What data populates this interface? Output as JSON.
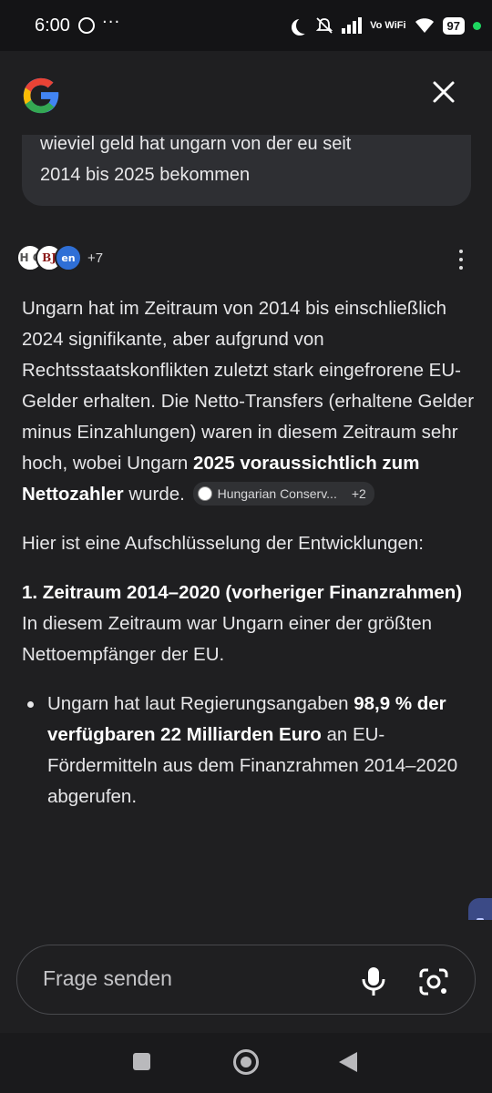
{
  "status_bar": {
    "time": "6:00",
    "overflow": "···",
    "network_label": "Vo WiFi",
    "battery": "97"
  },
  "header": {
    "logo": "google-g-icon",
    "close": "close-icon"
  },
  "query": {
    "text_line1": "wieviel geld hat ungarn von der eu seit",
    "text_line2": "2014 bis 2025 bekommen"
  },
  "sources": {
    "icons": [
      "H C",
      "BJ",
      "en"
    ],
    "more_count": "+7"
  },
  "answer": {
    "p1_text": "Ungarn hat im Zeitraum von 2014 bis einschließlich 2024 signifikante, aber aufgrund von Rechtsstaatskonflikten zuletzt stark eingefrorene EU-Gelder erhalten. Die Netto-Transfers (erhaltene Gelder minus Einzahlungen) waren in diesem Zeitraum sehr hoch, wobei Ungarn ",
    "p1_bold": "2025 voraussichtlich zum Nettozahler",
    "p1_end": " wurde.",
    "chip_label": "Hungarian Conserv...",
    "chip_more": "+2",
    "p2": "Hier ist eine Aufschlüsselung der Entwicklungen:",
    "section_heading": "1. Zeitraum 2014–2020 (vorheriger Finanzrahmen)",
    "section_text": "In diesem Zeitraum war Ungarn einer der größten Nettoempfänger der EU.",
    "bullet_pre": "Ungarn hat laut Regierungsangaben ",
    "bullet_bold": "98,9 % der verfügbaren 22 Milliarden Euro",
    "bullet_post": " an EU-Fördermitteln aus dem Finanzrahmen 2014–2020 abgerufen."
  },
  "input": {
    "placeholder": "Frage senden"
  },
  "colors": {
    "background": "#1f1f21",
    "card": "#2e2f33",
    "text": "#e6e6e8"
  }
}
